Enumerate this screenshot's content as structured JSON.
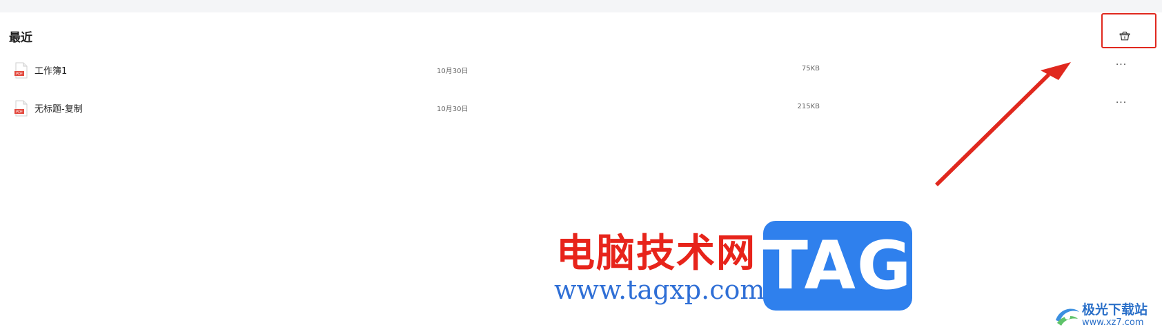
{
  "section": {
    "title": "最近"
  },
  "files": [
    {
      "name": "工作簿1",
      "date": "10月30日",
      "size": "75KB",
      "type_label": "PDF",
      "more_label": "···"
    },
    {
      "name": "无标题-复制",
      "date": "10月30日",
      "size": "215KB",
      "type_label": "PDF",
      "more_label": "···"
    }
  ],
  "toolbar": {
    "trash_icon": "recycle-bin-icon"
  },
  "annotation": {
    "highlight_color": "#e0281e",
    "arrow_color": "#e0281e"
  },
  "watermark": {
    "site_cn": "电脑技术网",
    "site_url": "www.tagxp.com",
    "tag_text": "TAG",
    "corner_name": "极光下载站",
    "corner_url": "www.xz7.com",
    "red": "#e7241b",
    "blue": "#2f80ed"
  }
}
